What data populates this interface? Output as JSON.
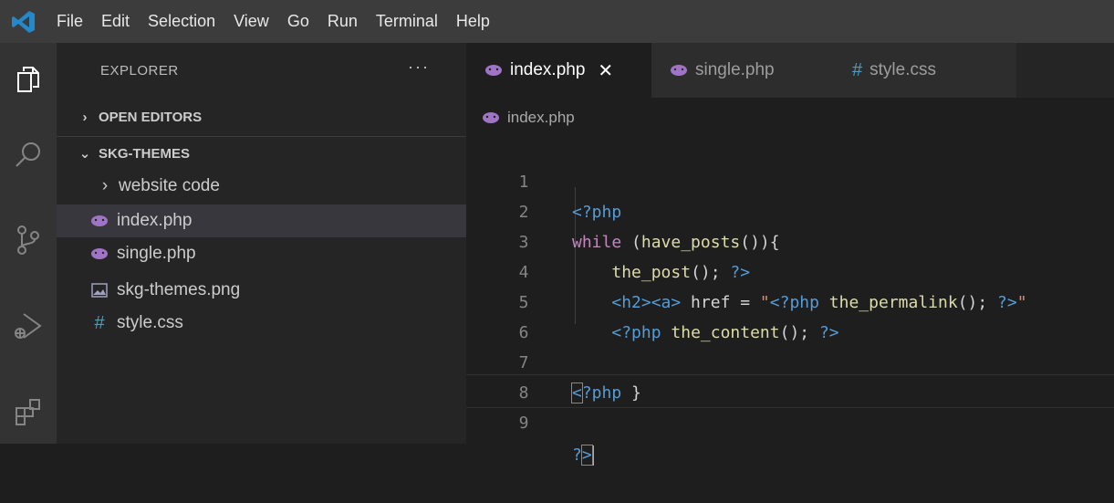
{
  "menubar": {
    "items": [
      "File",
      "Edit",
      "Selection",
      "View",
      "Go",
      "Run",
      "Terminal",
      "Help"
    ]
  },
  "activitybar": {
    "icons": [
      "files-icon",
      "search-icon",
      "source-control-icon",
      "run-debug-icon",
      "extensions-icon"
    ]
  },
  "sidebar": {
    "title": "EXPLORER",
    "more": "···",
    "open_editors": "OPEN EDITORS",
    "project": "SKG-THEMES",
    "items": [
      {
        "label": "website code",
        "type": "folder"
      },
      {
        "label": "index.php",
        "type": "php"
      },
      {
        "label": "single.php",
        "type": "php"
      },
      {
        "label": "skg-themes.png",
        "type": "image"
      },
      {
        "label": "style.css",
        "type": "css"
      }
    ]
  },
  "tabs": [
    {
      "label": "index.php",
      "active": true,
      "close": "✕"
    },
    {
      "label": "single.php",
      "active": false
    },
    {
      "label": "style.css",
      "active": false
    }
  ],
  "breadcrumb": "index.php",
  "code": {
    "line_numbers": [
      "1",
      "2",
      "3",
      "4",
      "5",
      "6",
      "7",
      "8",
      "9"
    ]
  },
  "colors": {
    "php_icon": "#a074c4",
    "css_hash": "#519aba",
    "editor_bg": "#1e1e1e",
    "sidebar_bg": "#252526",
    "menubar_bg": "#3c3c3c",
    "activitybar_bg": "#333333"
  }
}
